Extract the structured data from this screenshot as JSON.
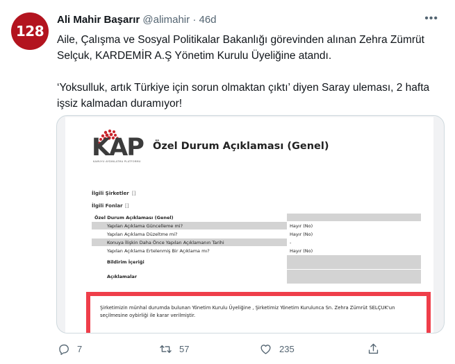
{
  "avatar": {
    "text": "128",
    "color": "#b3141f"
  },
  "tweet": {
    "display_name": "Ali Mahir Başarır",
    "handle": "@alimahir",
    "separator": "·",
    "time": "46d",
    "more_label": "•••",
    "paragraphs": [
      "Aile, Çalışma ve Sosyal Politikalar Bakanlığı görevinden alınan Zehra Zümrüt Selçuk, KARDEMİR A.Ş Yönetim Kurulu Üyeliğine atandı.",
      "‘Yoksulluk, artık Türkiye için sorun olmaktan çıktı’ diyen Saray uleması, 2 hafta işsiz kalmadan duramıyor!"
    ]
  },
  "document": {
    "logo_text": "KAP",
    "logo_subtext": "KAMUYU AYDINLATMA PLATFORMU",
    "title": "Özel Durum Açıklaması (Genel)",
    "meta": [
      {
        "label": "İlgili Şirketler",
        "sep": "[]"
      },
      {
        "label": "İlgili Fonlar",
        "sep": "[]"
      }
    ],
    "table_header": "Özel Durum Açıklaması (Genel)",
    "rows": [
      {
        "label": "Yapılan Açıklama Güncelleme mi?",
        "value": "Hayır (No)"
      },
      {
        "label": "Yapılan Açıklama Düzeltme mi?",
        "value": "Hayır (No)"
      },
      {
        "label": "Konuya İlişkin Daha Önce Yapılan Açıklamanın Tarihi",
        "value": "-"
      },
      {
        "label": "Yapılan Açıklama Ertelenmiş Bir Açıklama mı?",
        "value": "Hayır (No)"
      }
    ],
    "section_labels": [
      "Bildirim İçeriği",
      "Açıklamalar"
    ],
    "highlight_text": "Şirketimizin münhal durumda bulunan Yönetim Kurulu Üyeliğine , Şirketimiz Yönetim Kurulunca Sn. Zehra Zümrüt SELÇUK'un seçilmesine oybirliği ile karar verilmiştir.",
    "highlight_color": "#ef3e4a"
  },
  "actions": {
    "reply": {
      "icon": "reply-icon",
      "count": "7"
    },
    "retweet": {
      "icon": "retweet-icon",
      "count": "57"
    },
    "like": {
      "icon": "heart-icon",
      "count": "235"
    },
    "share": {
      "icon": "share-icon",
      "count": ""
    }
  },
  "colors": {
    "secondary_text": "#536471",
    "border": "#cfd9de"
  }
}
